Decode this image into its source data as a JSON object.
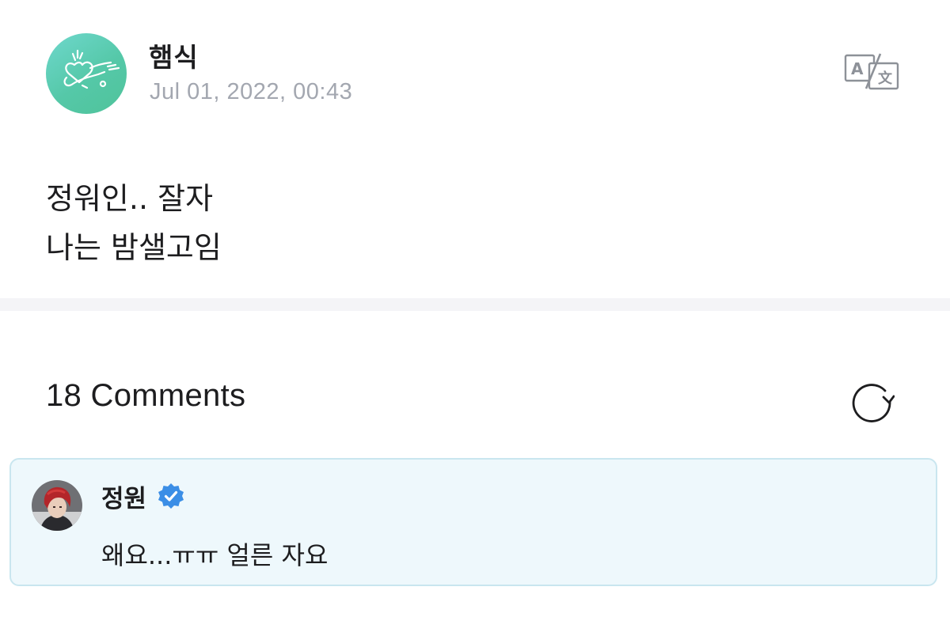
{
  "post": {
    "author": "햄식",
    "timestamp": "Jul 01, 2022, 00:43",
    "lines": [
      "정워인.. 잘자",
      "나는 밤샐고임"
    ],
    "avatar_icon": "heart-doodle-avatar",
    "translate_icon": "translate-icon"
  },
  "comments": {
    "count_label": "18 Comments",
    "refresh_icon": "refresh-icon",
    "items": [
      {
        "author": "정원",
        "verified": true,
        "text": "왜요...ㅠㅠ 얼른 자요",
        "avatar_icon": "user-photo-avatar"
      }
    ]
  },
  "colors": {
    "accent_teal": "#55c8a8",
    "timestamp_gray": "#a3a7b0",
    "comment_bg": "#eef8fc",
    "comment_border": "#c9e6ef",
    "verified_blue": "#3b8ee6",
    "divider": "#f4f4f7"
  }
}
